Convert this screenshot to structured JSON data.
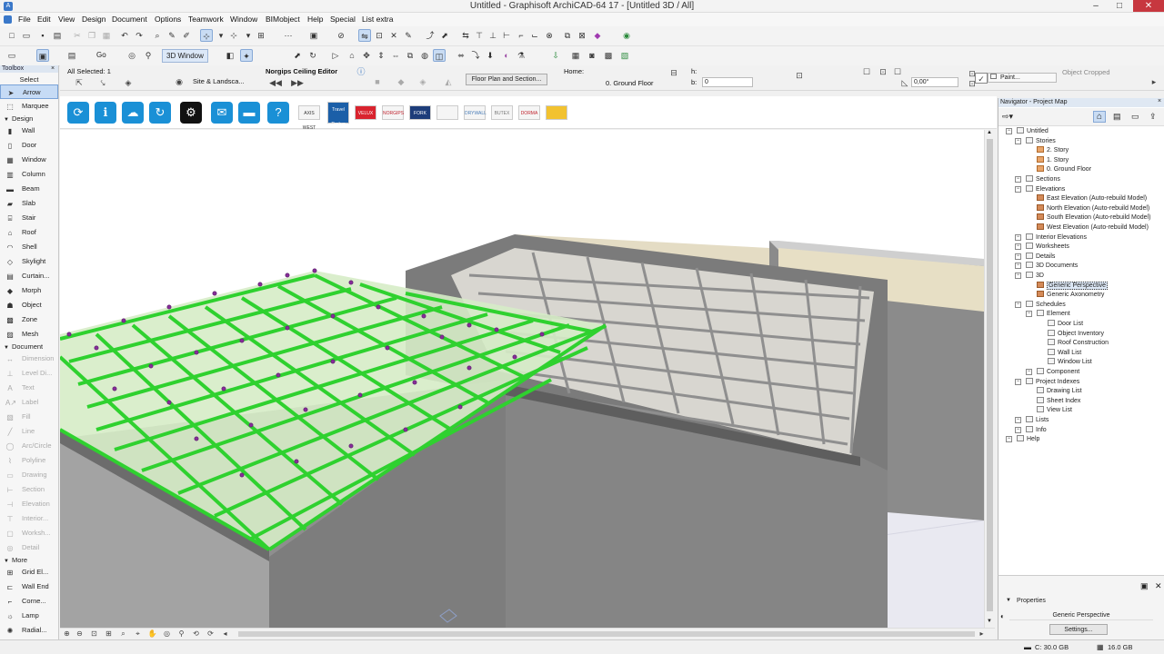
{
  "window": {
    "title": "Untitled - Graphisoft ArchiCAD-64 17 - [Untitled 3D / All]",
    "controls": {
      "minimize": "–",
      "maximize": "□",
      "close": "✕"
    }
  },
  "menu": [
    "File",
    "Edit",
    "View",
    "Design",
    "Document",
    "Options",
    "Teamwork",
    "Window",
    "BIMobject",
    "Help",
    "Special",
    "List extra"
  ],
  "toolbar2": {
    "go_label": "Go",
    "view3d_label": "3D Window"
  },
  "infobox": {
    "selection": "All Selected: 1",
    "editor_title": "Norgips Ceiling Editor",
    "site_button": "Site & Landsca...",
    "floorplan_button": "Floor Plan and Section...",
    "home_label": "Home:",
    "home_value": "0. Ground Floor",
    "h_label": "h:",
    "b_label": "b:",
    "b_value": "0",
    "angle_value": "0,00°",
    "paint_label": "Paint...",
    "object_status": "Object Cropped"
  },
  "toolbox": {
    "title": "Toolbox",
    "select_label": "Select",
    "sections": {
      "design": "Design",
      "document": "Document",
      "more": "More"
    },
    "select_items": [
      {
        "label": "Arrow",
        "icon": "arrow-icon"
      },
      {
        "label": "Marquee",
        "icon": "marquee-icon"
      }
    ],
    "design_items": [
      {
        "label": "Wall",
        "icon": "wall-icon"
      },
      {
        "label": "Door",
        "icon": "door-icon"
      },
      {
        "label": "Window",
        "icon": "window-icon"
      },
      {
        "label": "Column",
        "icon": "column-icon"
      },
      {
        "label": "Beam",
        "icon": "beam-icon"
      },
      {
        "label": "Slab",
        "icon": "slab-icon"
      },
      {
        "label": "Stair",
        "icon": "stair-icon"
      },
      {
        "label": "Roof",
        "icon": "roof-icon"
      },
      {
        "label": "Shell",
        "icon": "shell-icon"
      },
      {
        "label": "Skylight",
        "icon": "skylight-icon"
      },
      {
        "label": "Curtain...",
        "icon": "curtain-wall-icon"
      },
      {
        "label": "Morph",
        "icon": "morph-icon"
      },
      {
        "label": "Object",
        "icon": "object-icon"
      },
      {
        "label": "Zone",
        "icon": "zone-icon"
      },
      {
        "label": "Mesh",
        "icon": "mesh-icon"
      }
    ],
    "document_items": [
      {
        "label": "Dimension",
        "icon": "dimension-icon"
      },
      {
        "label": "Level Di...",
        "icon": "level-dimension-icon"
      },
      {
        "label": "Text",
        "icon": "text-icon"
      },
      {
        "label": "Label",
        "icon": "label-icon"
      },
      {
        "label": "Fill",
        "icon": "fill-icon"
      },
      {
        "label": "Line",
        "icon": "line-icon"
      },
      {
        "label": "Arc/Circle",
        "icon": "arc-icon"
      },
      {
        "label": "Polyline",
        "icon": "polyline-icon"
      },
      {
        "label": "Drawing",
        "icon": "drawing-icon"
      },
      {
        "label": "Section",
        "icon": "section-icon"
      },
      {
        "label": "Elevation",
        "icon": "elevation-icon"
      },
      {
        "label": "Interior...",
        "icon": "interior-elevation-icon"
      },
      {
        "label": "Worksh...",
        "icon": "worksheet-icon"
      },
      {
        "label": "Detail",
        "icon": "detail-icon"
      }
    ],
    "more_items": [
      {
        "label": "Grid El...",
        "icon": "grid-element-icon"
      },
      {
        "label": "Wall End",
        "icon": "wall-end-icon"
      },
      {
        "label": "Corne...",
        "icon": "corner-window-icon"
      },
      {
        "label": "Lamp",
        "icon": "lamp-icon"
      },
      {
        "label": "Radial...",
        "icon": "radial-icon"
      }
    ]
  },
  "gdl_toolbar": {
    "icons": [
      "cloud-sync-icon",
      "info-icon",
      "cloud-icon",
      "refresh-icon",
      "settings-icon",
      "mail-icon",
      "toolbox-icon",
      "help-icon"
    ],
    "logos": [
      "AXIS WEST",
      "Travel Timber",
      "VELUX",
      "NORGIPS",
      "FORK",
      "",
      "DRYWALL",
      "BUTEX",
      "DORMA",
      ""
    ]
  },
  "navigator": {
    "title": "Navigator - Project Map",
    "tree": [
      {
        "label": "Untitled",
        "level": 0,
        "icon": "project"
      },
      {
        "label": "Stories",
        "level": 1,
        "icon": "folder"
      },
      {
        "label": "2. Story",
        "level": 2,
        "icon": "story"
      },
      {
        "label": "1. Story",
        "level": 2,
        "icon": "story"
      },
      {
        "label": "0. Ground Floor",
        "level": 2,
        "icon": "story"
      },
      {
        "label": "Sections",
        "level": 1,
        "icon": "folder"
      },
      {
        "label": "Elevations",
        "level": 1,
        "icon": "folder"
      },
      {
        "label": "East Elevation (Auto-rebuild Model)",
        "level": 2,
        "icon": "elev"
      },
      {
        "label": "North Elevation (Auto-rebuild Model)",
        "level": 2,
        "icon": "elev"
      },
      {
        "label": "South Elevation (Auto-rebuild Model)",
        "level": 2,
        "icon": "elev"
      },
      {
        "label": "West Elevation (Auto-rebuild Model)",
        "level": 2,
        "icon": "elev"
      },
      {
        "label": "Interior Elevations",
        "level": 1,
        "icon": "folder"
      },
      {
        "label": "Worksheets",
        "level": 1,
        "icon": "folder"
      },
      {
        "label": "Details",
        "level": 1,
        "icon": "folder"
      },
      {
        "label": "3D Documents",
        "level": 1,
        "icon": "folder"
      },
      {
        "label": "3D",
        "level": 1,
        "icon": "folder"
      },
      {
        "label": "Generic Perspective",
        "level": 2,
        "icon": "elev",
        "selected": true
      },
      {
        "label": "Generic Axonometry",
        "level": 2,
        "icon": "elev"
      },
      {
        "label": "Schedules",
        "level": 1,
        "icon": "folder"
      },
      {
        "label": "Element",
        "level": 2,
        "icon": "folder"
      },
      {
        "label": "Door List",
        "level": 3,
        "icon": "doc"
      },
      {
        "label": "Object Inventory",
        "level": 3,
        "icon": "doc"
      },
      {
        "label": "Roof Construction",
        "level": 3,
        "icon": "doc"
      },
      {
        "label": "Wall List",
        "level": 3,
        "icon": "doc"
      },
      {
        "label": "Window List",
        "level": 3,
        "icon": "doc"
      },
      {
        "label": "Component",
        "level": 2,
        "icon": "folder"
      },
      {
        "label": "Project Indexes",
        "level": 1,
        "icon": "folder"
      },
      {
        "label": "Drawing List",
        "level": 2,
        "icon": "doc"
      },
      {
        "label": "Sheet Index",
        "level": 2,
        "icon": "doc"
      },
      {
        "label": "View List",
        "level": 2,
        "icon": "doc"
      },
      {
        "label": "Lists",
        "level": 1,
        "icon": "folder"
      },
      {
        "label": "Info",
        "level": 1,
        "icon": "folder"
      },
      {
        "label": "Help",
        "level": 0,
        "icon": "folder"
      }
    ],
    "properties": {
      "title": "Properties",
      "value": "Generic Perspective",
      "settings_button": "Settings..."
    }
  },
  "status": {
    "disk_c": "C: 30.0 GB",
    "ram": "16.0 GB"
  },
  "colors": {
    "selection_green": "#2fd12f",
    "wall_grey": "#8a8a8a",
    "grid_grey": "#9a9a9a",
    "accent_blue": "#3a78c9"
  }
}
